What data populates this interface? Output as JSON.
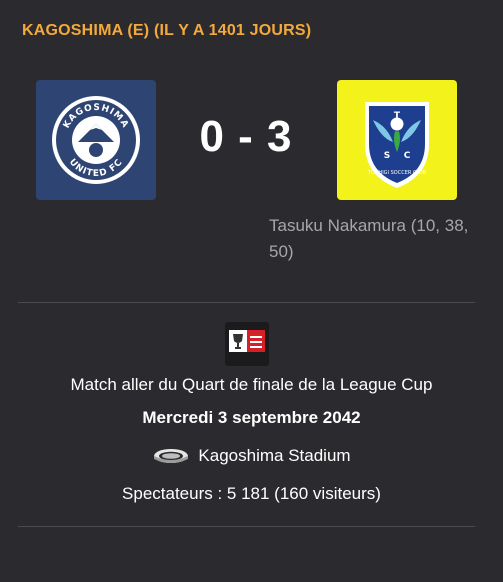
{
  "header": {
    "title": "KAGOSHIMA (E) (IL Y A 1401 JOURS)"
  },
  "match": {
    "home_team": {
      "badge_text_top": "KAGOSHIMA",
      "badge_text_bottom": "UNITED FC",
      "badge_color": "#2e4573"
    },
    "away_team": {
      "badge_text": "TOCHIGI SOCCER CLUB",
      "badge_letters": "T S C",
      "badge_color": "#f3f21a"
    },
    "score": "0 - 3",
    "scorers": "Tasuku Nakamura (10, 38, 50)"
  },
  "details": {
    "competition_logo": "league-cup-icon",
    "round": "Match aller du Quart de finale de la League Cup",
    "date": "Mercredi 3 septembre 2042",
    "stadium_icon": "stadium-icon",
    "stadium": "Kagoshima Stadium",
    "attendance": "Spectateurs : 5 181 (160 visiteurs)"
  },
  "colors": {
    "accent": "#f3a93b",
    "background": "#2b2b2f",
    "muted_text": "#a6a6ab"
  }
}
